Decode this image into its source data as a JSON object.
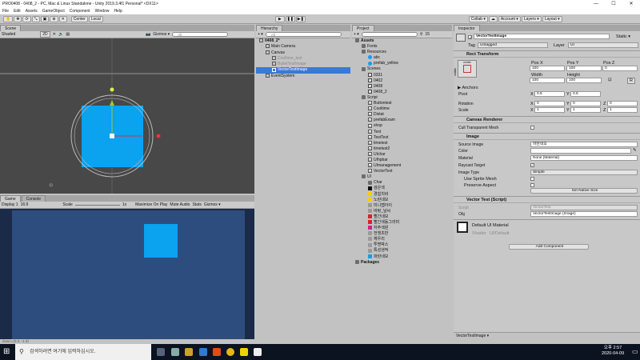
{
  "window": {
    "title": "PRO0408 - 0408_2 - PC, Mac & Linux Standalone - Unity 2019.3.4f1 Personal* <DX11>",
    "min": "—",
    "max": "☐",
    "close": "✕"
  },
  "menu": [
    "File",
    "Edit",
    "Assets",
    "GameObject",
    "Component",
    "Window",
    "Help"
  ],
  "toolbar": {
    "center": "Center",
    "local": "Local",
    "play": "▶",
    "pause": "❚❚",
    "step": "▶❚",
    "collab": "Collab ▾",
    "account": "Account ▾",
    "layers": "Layers ▾",
    "layout": "Layout ▾"
  },
  "scene": {
    "tab": "Scene",
    "shading": "Shaded",
    "mode2d": "2D",
    "gizmos": "Gizmos ▾",
    "search": "All"
  },
  "game": {
    "tab": "Game",
    "console_tab": "Console",
    "display": "Display 1",
    "aspect": "16:9",
    "scale_label": "Scale",
    "scale_value": "1x",
    "maximize": "Maximize On Play",
    "mute": "Mute Audio",
    "stats": "Stats",
    "gizmos": "Gizmos ▾"
  },
  "hierarchy": {
    "tab": "Hierarchy",
    "create": "+ ▾",
    "search": "All",
    "items": [
      {
        "label": "0408_2*",
        "depth": 0,
        "bold": true,
        "sel": false,
        "grey": false
      },
      {
        "label": "Main Camera",
        "depth": 1,
        "bold": false,
        "sel": false,
        "grey": false
      },
      {
        "label": "Canvas",
        "depth": 1,
        "bold": false,
        "sel": false,
        "grey": false
      },
      {
        "label": "Cooltime_test",
        "depth": 2,
        "bold": false,
        "sel": false,
        "grey": true
      },
      {
        "label": "BulletTestImage",
        "depth": 2,
        "bold": false,
        "sel": false,
        "grey": true
      },
      {
        "label": "VectorTestImage",
        "depth": 2,
        "bold": false,
        "sel": true,
        "grey": false
      },
      {
        "label": "EventSystem",
        "depth": 1,
        "bold": false,
        "sel": false,
        "grey": false
      }
    ]
  },
  "project": {
    "tab": "Project",
    "create": "+ ▾",
    "count": "15",
    "items": [
      {
        "label": "Assets",
        "depth": 0,
        "icon": "folder",
        "bold": true
      },
      {
        "label": "Fonts",
        "depth": 1,
        "icon": "folder",
        "bold": false
      },
      {
        "label": "Resources",
        "depth": 1,
        "icon": "folder",
        "bold": false
      },
      {
        "label": "abc",
        "depth": 2,
        "icon": "blue",
        "bold": false
      },
      {
        "label": "prefab_yellow",
        "depth": 2,
        "icon": "blue",
        "bold": false
      },
      {
        "label": "Scenes",
        "depth": 1,
        "icon": "folder",
        "bold": false
      },
      {
        "label": "0331",
        "depth": 2,
        "icon": "scene",
        "bold": false
      },
      {
        "label": "0402",
        "depth": 2,
        "icon": "scene",
        "bold": false
      },
      {
        "label": "0408",
        "depth": 2,
        "icon": "scene",
        "bold": false
      },
      {
        "label": "0408_2",
        "depth": 2,
        "icon": "scene",
        "bold": false
      },
      {
        "label": "Script",
        "depth": 1,
        "icon": "folder",
        "bold": false
      },
      {
        "label": "Buttontest",
        "depth": 2,
        "icon": "cs",
        "bold": false
      },
      {
        "label": "Cooltime",
        "depth": 2,
        "icon": "cs",
        "bold": false
      },
      {
        "label": "Distat",
        "depth": 2,
        "icon": "cs",
        "bold": false
      },
      {
        "label": "prefabExam",
        "depth": 2,
        "icon": "cs",
        "bold": false
      },
      {
        "label": "shop",
        "depth": 2,
        "icon": "cs",
        "bold": false
      },
      {
        "label": "Test",
        "depth": 2,
        "icon": "cs",
        "bold": false
      },
      {
        "label": "TestTest",
        "depth": 2,
        "icon": "cs",
        "bold": false
      },
      {
        "label": "timetest",
        "depth": 2,
        "icon": "cs",
        "bold": false
      },
      {
        "label": "timetest2",
        "depth": 2,
        "icon": "cs",
        "bold": false
      },
      {
        "label": "UIchar",
        "depth": 2,
        "icon": "cs",
        "bold": false
      },
      {
        "label": "UIhpbar",
        "depth": 2,
        "icon": "cs",
        "bold": false
      },
      {
        "label": "UImanagement",
        "depth": 2,
        "icon": "cs",
        "bold": false
      },
      {
        "label": "VectorTest",
        "depth": 2,
        "icon": "cs",
        "bold": false
      },
      {
        "label": "UI",
        "depth": 1,
        "icon": "folder",
        "bold": false
      },
      {
        "label": "Char",
        "depth": 2,
        "icon": "folder",
        "bold": false
      },
      {
        "label": "검은색",
        "depth": 2,
        "icon": "black",
        "bold": false
      },
      {
        "label": "경험치바",
        "depth": 2,
        "icon": "yellow",
        "bold": false
      },
      {
        "label": "노란네모",
        "depth": 2,
        "icon": "yellow",
        "bold": false
      },
      {
        "label": "미니맵아이",
        "depth": 2,
        "icon": "grey",
        "bold": false
      },
      {
        "label": "바탕_날씨",
        "depth": 2,
        "icon": "grey",
        "bold": false
      },
      {
        "label": "빨간네모",
        "depth": 2,
        "icon": "red",
        "bold": false
      },
      {
        "label": "빨간색동그라미",
        "depth": 2,
        "icon": "red",
        "bold": false
      },
      {
        "label": "자주색원",
        "depth": 2,
        "icon": "magenta",
        "bold": false
      },
      {
        "label": "전쟁초반",
        "depth": 2,
        "icon": "grey",
        "bold": false
      },
      {
        "label": "체우리",
        "depth": 2,
        "icon": "grey",
        "bold": false
      },
      {
        "label": "투명박스",
        "depth": 2,
        "icon": "grey",
        "bold": false
      },
      {
        "label": "특성생적",
        "depth": 2,
        "icon": "grey",
        "bold": false
      },
      {
        "label": "파란네모",
        "depth": 2,
        "icon": "blue",
        "bold": false
      },
      {
        "label": "Packages",
        "depth": 0,
        "icon": "folder",
        "bold": true
      }
    ]
  },
  "inspector": {
    "tab": "Inspector",
    "name": "VectorTestImage",
    "static": "Static ▾",
    "tag_label": "Tag",
    "tag_value": "Untagged",
    "layer_label": "Layer",
    "layer_value": "UI",
    "rect": {
      "title": "Rect Transform",
      "preset_top": "center",
      "preset_side": "middle",
      "posx_label": "Pos X",
      "posy_label": "Pos Y",
      "posz_label": "Pos Z",
      "posx": "100",
      "posy": "100",
      "posz": "0",
      "width_label": "Width",
      "height_label": "Height",
      "width": "100",
      "height": "100",
      "anchors": "▶ Anchors",
      "pivot_label": "Pivot",
      "pivot_x": "0.5",
      "pivot_y": "0.5",
      "rotation_label": "Rotation",
      "rot_x": "0",
      "rot_y": "0",
      "rot_z": "0",
      "scale_label": "Scale",
      "scale_x": "1",
      "scale_y": "1",
      "scale_z": "1",
      "x": "X",
      "y": "Y",
      "z": "Z",
      "r": "R"
    },
    "canvas_renderer": {
      "title": "Canvas Renderer",
      "cull": "Cull Transparent Mesh"
    },
    "image": {
      "title": "Image",
      "source_label": "Source Image",
      "source_value": "파란네모",
      "color_label": "Color",
      "material_label": "Material",
      "material_value": "None (Material)",
      "raycast_label": "Raycast Target",
      "type_label": "Image Type",
      "type_value": "Simple",
      "sprite_mesh": "Use Sprite Mesh",
      "preserve": "Preserve Aspect",
      "native_btn": "Set Native Size"
    },
    "vector_test": {
      "title": "Vector Test (Script)",
      "script_label": "Script",
      "script_value": "VectorTest",
      "obj_label": "Obj",
      "obj_value": "VectorTestImage (Image)"
    },
    "material": {
      "title": "Default UI Material",
      "shader_label": "Shader",
      "shader_value": "UI/Default"
    },
    "add_component": "Add Component",
    "footer": "VectorTestImage ▾"
  },
  "status": "down=(0.0, -1.0)",
  "taskbar": {
    "search": "검색하려면 여기에 입력하십시오.",
    "time": "오후 2:57",
    "date": "2020-04-09"
  },
  "colors": {
    "accent": "#3b78d8",
    "ui_blue": "#0ba2f0",
    "game_bg": "#2e4d7f",
    "scene_bg": "#484848"
  }
}
